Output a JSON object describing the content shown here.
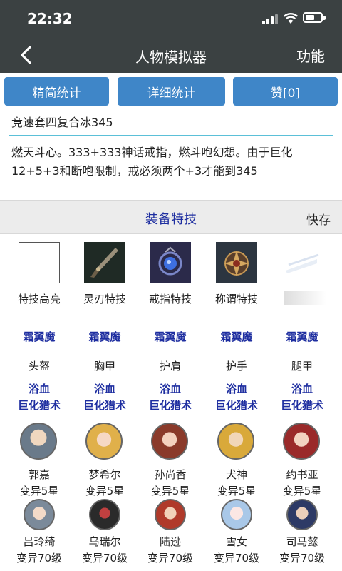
{
  "status": {
    "time": "22:32"
  },
  "nav": {
    "title": "人物模拟器",
    "func_label": "功能"
  },
  "buttons": {
    "simple_stats": "精简统计",
    "detail_stats": "详细统计",
    "like": "赞[0]"
  },
  "build": {
    "name": "竞速套四复合冰345",
    "description": "燃天斗心。333+333神话戒指，燃斗咆幻想。由于巨化12+5+3和断咆限制，戒必须两个+3才能到345"
  },
  "section": {
    "title": "装备特技",
    "quick_save": "快存"
  },
  "special_slots": [
    {
      "label": "特技高亮",
      "icon": "empty-slot-icon"
    },
    {
      "label": "灵刃特技",
      "icon": "blade-icon"
    },
    {
      "label": "戒指特技",
      "icon": "ring-icon"
    },
    {
      "label": "称谓特技",
      "icon": "title-emblem-icon"
    },
    {
      "label": "",
      "icon": "faded-icon"
    }
  ],
  "armor": [
    {
      "enchant": "霜翼魔",
      "slot": "头盔",
      "skill1": "浴血",
      "skill2": "巨化猎术"
    },
    {
      "enchant": "霜翼魔",
      "slot": "胸甲",
      "skill1": "浴血",
      "skill2": "巨化猎术"
    },
    {
      "enchant": "霜翼魔",
      "slot": "护肩",
      "skill1": "浴血",
      "skill2": "巨化猎术"
    },
    {
      "enchant": "霜翼魔",
      "slot": "护手",
      "skill1": "浴血",
      "skill2": "巨化猎术"
    },
    {
      "enchant": "霜翼魔",
      "slot": "腿甲",
      "skill1": "浴血",
      "skill2": "巨化猎术"
    }
  ],
  "heroes_row1": [
    {
      "name": "郭嘉",
      "rank": "变异5星"
    },
    {
      "name": "梦希尔",
      "rank": "变异5星"
    },
    {
      "name": "孙尚香",
      "rank": "变异5星"
    },
    {
      "name": "犬神",
      "rank": "变异5星"
    },
    {
      "name": "约书亚",
      "rank": "变异5星"
    }
  ],
  "heroes_row2": [
    {
      "name": "吕玲绮",
      "rank": "变异70级"
    },
    {
      "name": "乌瑞尔",
      "rank": "变异70级"
    },
    {
      "name": "陆逊",
      "rank": "变异70级"
    },
    {
      "name": "雪女",
      "rank": "变异70级"
    },
    {
      "name": "司马懿",
      "rank": "变异70级"
    }
  ],
  "colors": {
    "bar": "#3b4142",
    "button": "#3f86c8",
    "accent_text": "#1e2ea0",
    "divider": "#5bc0d8"
  }
}
